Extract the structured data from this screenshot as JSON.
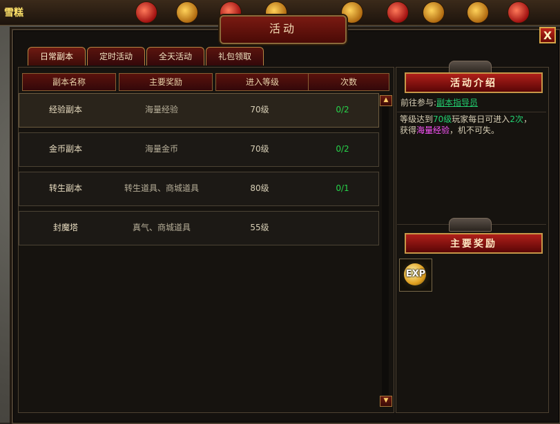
{
  "player": {
    "name": "雪糕"
  },
  "window": {
    "title": "活动",
    "close_label": "X"
  },
  "tabs": [
    {
      "label": "日常副本",
      "active": true
    },
    {
      "label": "定时活动",
      "active": false
    },
    {
      "label": "全天活动",
      "active": false
    },
    {
      "label": "礼包领取",
      "active": false
    }
  ],
  "table": {
    "headers": [
      "副本名称",
      "主要奖励",
      "进入等级",
      "次数"
    ],
    "rows": [
      {
        "name": "经验副本",
        "reward": "海量经验",
        "level": "70级",
        "count": "0/2"
      },
      {
        "name": "金币副本",
        "reward": "海量金币",
        "level": "70级",
        "count": "0/2"
      },
      {
        "name": "转生副本",
        "reward": "转生道具、商城道具",
        "level": "80级",
        "count": "0/1"
      },
      {
        "name": "封魔塔",
        "reward": "真气、商城道具",
        "level": "55级",
        "count": ""
      }
    ]
  },
  "side": {
    "intro_title": "活动介绍",
    "goto_label": "前往参与:",
    "npc_name": "副本指导员",
    "desc": {
      "p1": "等级达到",
      "level": "70级",
      "p2": "玩家每日可进入",
      "times": "2次",
      "p3": "，",
      "p4": "获得",
      "reward": "海量经验",
      "p5": "，机不可失。"
    },
    "reward_title": "主要奖励",
    "reward_item": "EXP"
  },
  "colors": {
    "count_green": "#26d54a",
    "highlight_green": "#22d070",
    "highlight_pink": "#ff55ff",
    "title_red": "#b0201a"
  }
}
